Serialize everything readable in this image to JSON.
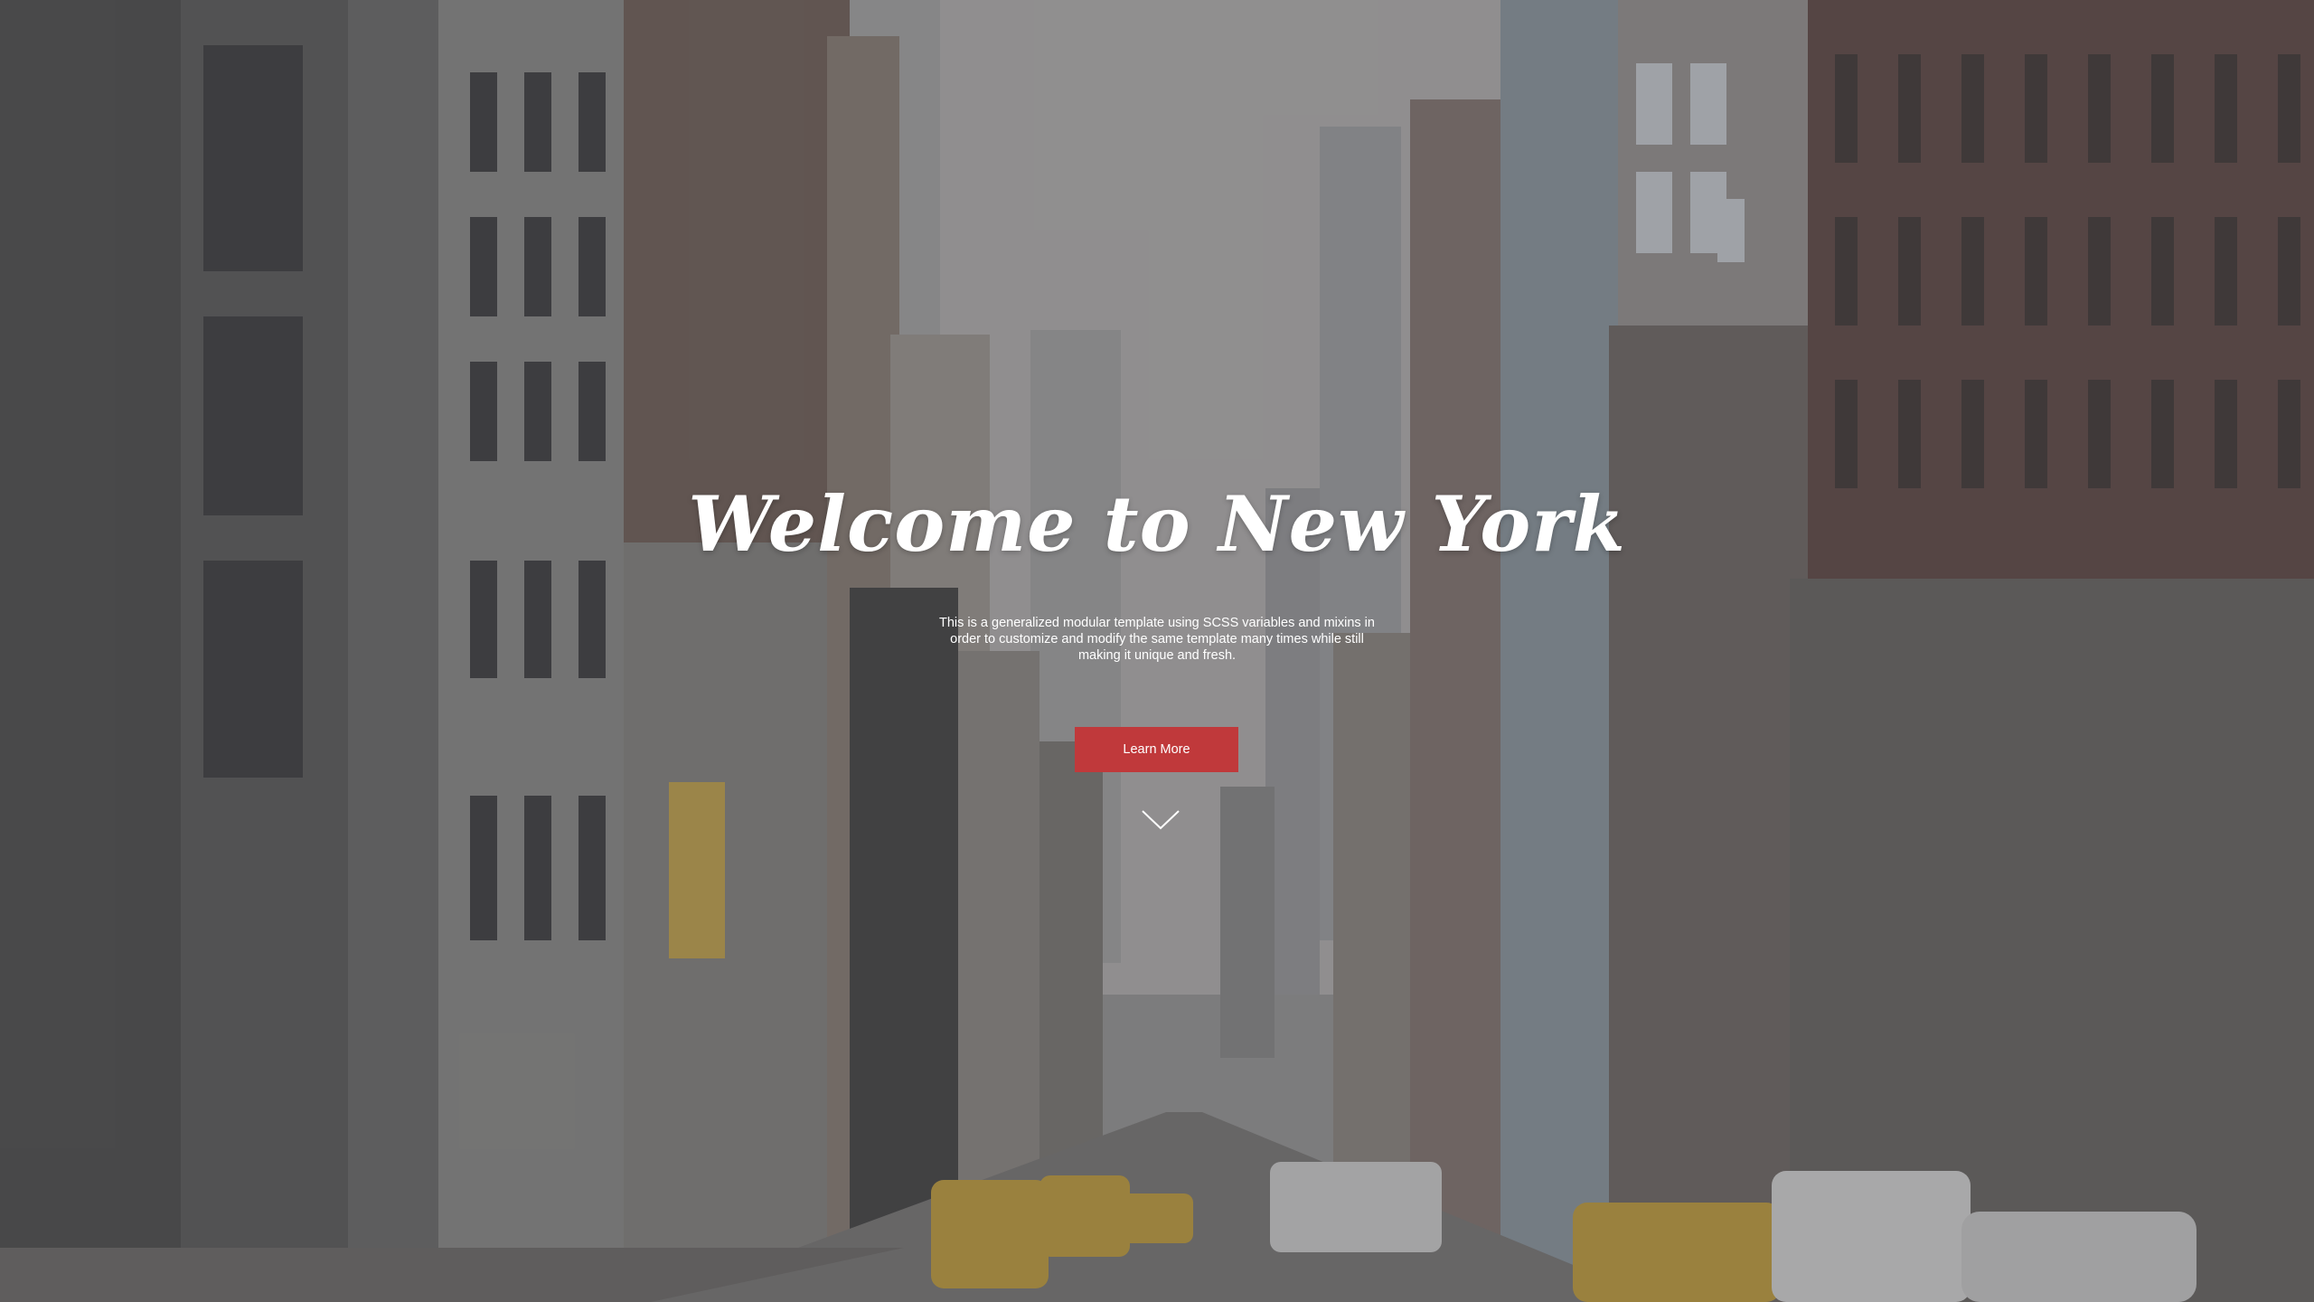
{
  "hero": {
    "title": "Welcome to New York",
    "description": "This is a generalized modular template using SCSS variables and mixins in order to customize and modify the same template many times while still making it unique and fresh.",
    "button_label": "Learn More",
    "scroll_indicator_icon": "chevron-down-icon",
    "background_image": "new-york-street-photo"
  },
  "colors": {
    "accent": "#c0393b",
    "text": "#ffffff",
    "overlay": "#464648"
  }
}
